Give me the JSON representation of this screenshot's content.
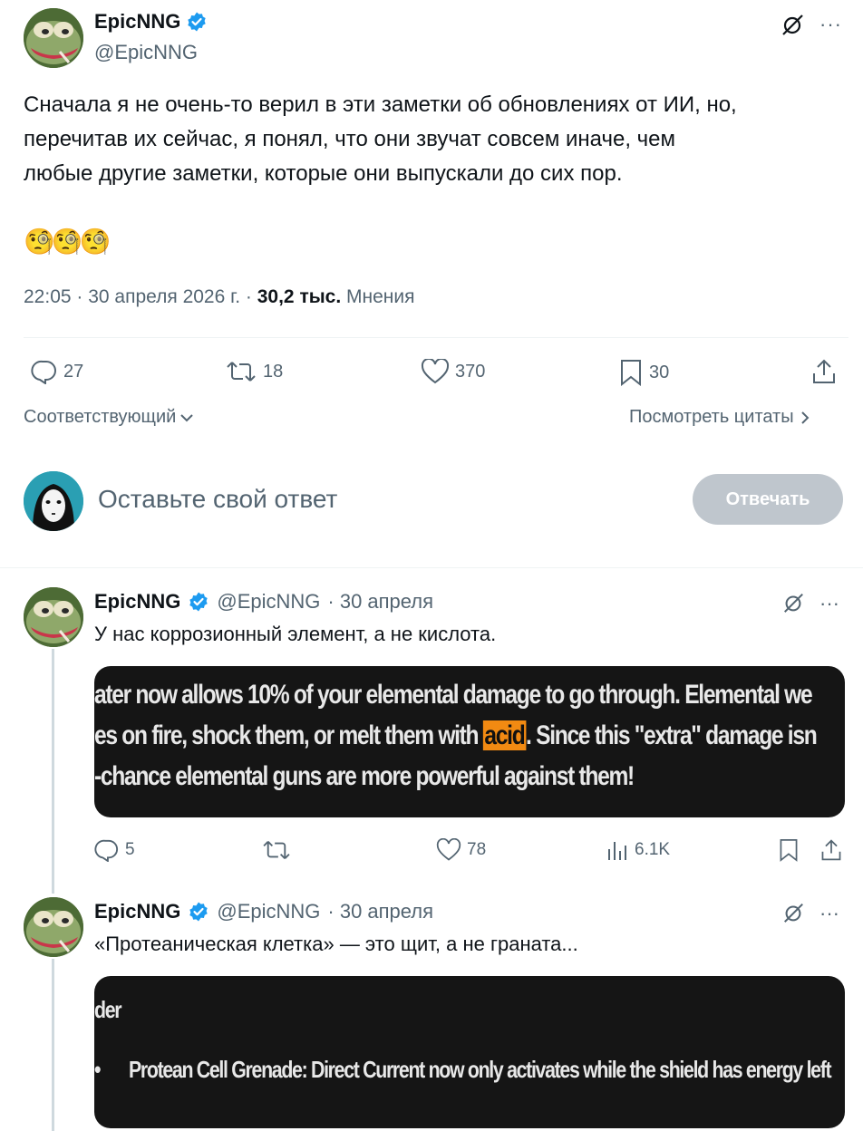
{
  "main_tweet": {
    "author_name": "EpicNNG",
    "author_handle": "@EpicNNG",
    "text_line1": "Сначала я не очень-то верил в эти заметки об обновлениях от ИИ, но,",
    "text_line2": "перечитав их сейчас, я понял, что они звучат совсем иначе, чем",
    "text_line3": "любые другие заметки, которые они выпускали до сих пор.",
    "emoji": "🧐🧐🧐",
    "time": "22:05 · 30 апреля 2026 г. · ",
    "views_count": "30,2 тыс.",
    "views_label": "Мнения",
    "replies": "27",
    "retweets": "18",
    "likes": "370",
    "bookmarks": "30",
    "sort_label": "Соответствующий",
    "quotes_label": "Посмотреть цитаты"
  },
  "reply_composer": {
    "placeholder": "Оставьте свой ответ",
    "button_label": "Отвечать"
  },
  "replies": [
    {
      "author_name": "EpicNNG",
      "author_handle": "@EpicNNG",
      "date": "· 30 апреля",
      "text": "У нас коррозионный элемент, а не кислота.",
      "media_line1": "ater now allows 10% of your elemental damage to go through. Elemental we",
      "media_line2_a": "es on fire, shock them, or melt them with ",
      "media_line2_hl": "acid",
      "media_line2_b": ". Since this \"extra\" damage isn",
      "media_line3": "-chance elemental guns are more powerful against them!",
      "replies": "5",
      "likes": "78",
      "views": "6.1K"
    },
    {
      "author_name": "EpicNNG",
      "author_handle": "@EpicNNG",
      "date": "· 30 апреля",
      "text": "«Протеаническая клетка» — это щит, а не граната...",
      "media_line1": "der",
      "media_bullet": "•",
      "media_line2": "Protean Cell Grenade: Direct Current now only activates while the shield has energy left"
    }
  ],
  "colors": {
    "accent_verified": "#1d9bf0",
    "muted_text": "#536471",
    "highlight": "#f28a12"
  }
}
